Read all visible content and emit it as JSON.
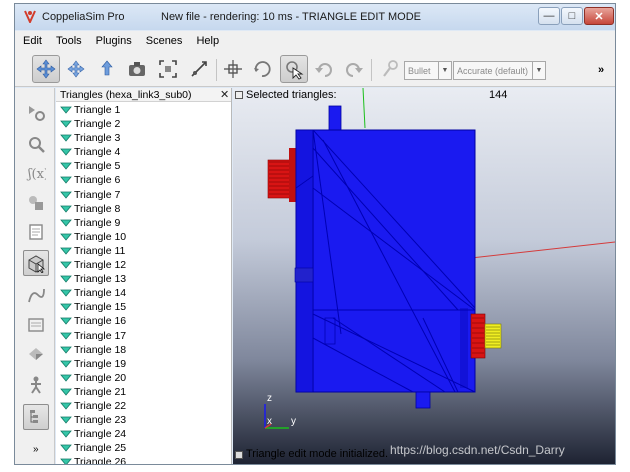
{
  "window": {
    "app_name": "CoppeliaSim Pro",
    "title": "New file - rendering: 10 ms - TRIANGLE EDIT MODE",
    "minimize": "—",
    "maximize": "□",
    "close": "✕"
  },
  "menubar": {
    "items": [
      "Edit",
      "Tools",
      "Plugins",
      "Scenes",
      "Help"
    ]
  },
  "toolbar": {
    "engine_select": "Bullet",
    "accuracy_select": "Accurate (default)",
    "overflow": "»",
    "icons": [
      "camera-pan-icon",
      "camera-rotate-icon",
      "camera-shift-icon",
      "camera-view-icon",
      "fit-to-view-icon",
      "manipulate-icon",
      "object-shift-icon",
      "object-rotate-icon",
      "click-select-icon",
      "undo-icon",
      "redo-icon",
      "dynamics-icon"
    ]
  },
  "left_toolbar": {
    "icons": [
      "scene-object-properties-icon",
      "calculation-modules-icon",
      "collections-icon",
      "scripts-icon",
      "shape-edit-icon",
      "path-edit-icon",
      "selection-icon",
      "model-browser-icon",
      "scene-hierarchy-icon",
      "layers-icon",
      "video-recorder-icon",
      "user-settings-icon"
    ],
    "more": "»"
  },
  "panel": {
    "title": "Triangles (hexa_link3_sub0)",
    "close": "✕",
    "triangles": [
      "Triangle 1",
      "Triangle 2",
      "Triangle 3",
      "Triangle 4",
      "Triangle 5",
      "Triangle 6",
      "Triangle 7",
      "Triangle 8",
      "Triangle 9",
      "Triangle 10",
      "Triangle 11",
      "Triangle 12",
      "Triangle 13",
      "Triangle 14",
      "Triangle 15",
      "Triangle 16",
      "Triangle 17",
      "Triangle 18",
      "Triangle 19",
      "Triangle 20",
      "Triangle 21",
      "Triangle 22",
      "Triangle 23",
      "Triangle 24",
      "Triangle 25",
      "Triangle 26"
    ]
  },
  "viewport": {
    "selected_label": "Selected triangles:",
    "selected_count": "144",
    "status": "Triangle edit mode initialized.",
    "axis_labels": {
      "z": "z",
      "x": "x",
      "y": "y"
    },
    "colors": {
      "mesh": "#1a1af0",
      "edge": "#0000b4",
      "red_part": "#e01010",
      "yellow_part": "#f0f020"
    }
  },
  "watermark": "https://blog.csdn.net/Csdn_Darry"
}
